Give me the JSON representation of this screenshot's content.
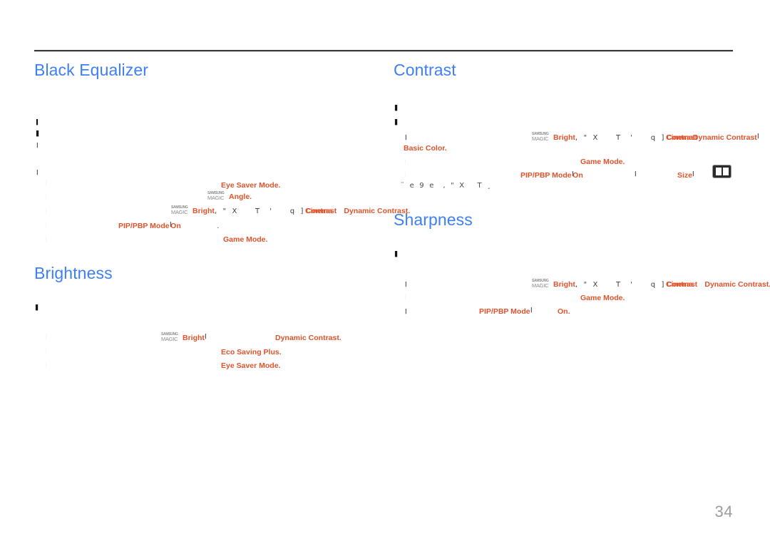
{
  "document": {
    "page_number": "34",
    "accent_heading_color": "#3d7ff5",
    "highlight_color": "#e0532a",
    "rule_color": "#3a3a3a",
    "page_number_color": "#9b9b9b"
  },
  "logo_mark": {
    "line1": "SAMSUNG",
    "line2": "MAGIC"
  },
  "sections": {
    "black_equalizer": {
      "title": "Black Equalizer",
      "body_glyphs": [
        "■h",
        "■■h",
        "■■",
        "■",
        "■h",
        "■"
      ],
      "sub_glyphs": [
        "■h",
        "■h",
        "■",
        "■",
        "■h"
      ],
      "terms": {
        "eye_saver_mode": "Eye Saver Mode",
        "magic_angle": "Angle",
        "magic_bright": "Bright",
        "cinema": "Cinema",
        "contrast_overlap": "Contrast",
        "dynamic_contrast": "Dynamic Contrast",
        "pip_pbp_mode": "PIP/PBP Mode",
        "on": "On",
        "game_mode": "Game Mode"
      },
      "garbled": ", \" X    T  '    q ]"
    },
    "brightness": {
      "title": "Brightness",
      "body_glyphs": [
        "■■",
        "■h"
      ],
      "sub_glyphs": [
        "■h",
        "■h",
        "■h"
      ],
      "terms": {
        "magic_bright": "Bright",
        "dynamic_contrast": "Dynamic Contrast",
        "eco_saving_plus": "Eco Saving Plus",
        "eye_saver_mode": "Eye Saver Mode"
      }
    },
    "contrast": {
      "title": "Contrast",
      "body_glyphs": [
        "■■",
        "■■"
      ],
      "sub_glyphs": [
        "■",
        "■h",
        "■h"
      ],
      "terms": {
        "magic_bright": "Bright",
        "cinema": "Cinema",
        "contrast_overlap": "Contrast",
        "dynamic_contrast": "Dynamic Contrast",
        "basic_color": "Basic Color",
        "game_mode": "Game Mode",
        "pip_pbp_mode": "PIP/PBP Mode",
        "on": "On",
        "size": "Size"
      },
      "garbled": ", \" X    T  '    q ]",
      "garbled_second_line": "¨ e 9 e  , \" X   T ¸",
      "icon": "pbp-layout-icon"
    },
    "sharpness": {
      "title": "Sharpness",
      "body_glyphs": [
        "■■",
        "■h"
      ],
      "sub_glyphs": [
        "■",
        "■h",
        "■"
      ],
      "terms": {
        "magic_bright": "Bright",
        "cinema": "Cinema",
        "contrast_overlap": "Contrast",
        "dynamic_contrast": "Dynamic Contrast",
        "game_mode": "Game Mode",
        "pip_pbp_mode": "PIP/PBP Mode",
        "on": "On"
      },
      "garbled": ", \" X    T  '    q ]"
    }
  }
}
